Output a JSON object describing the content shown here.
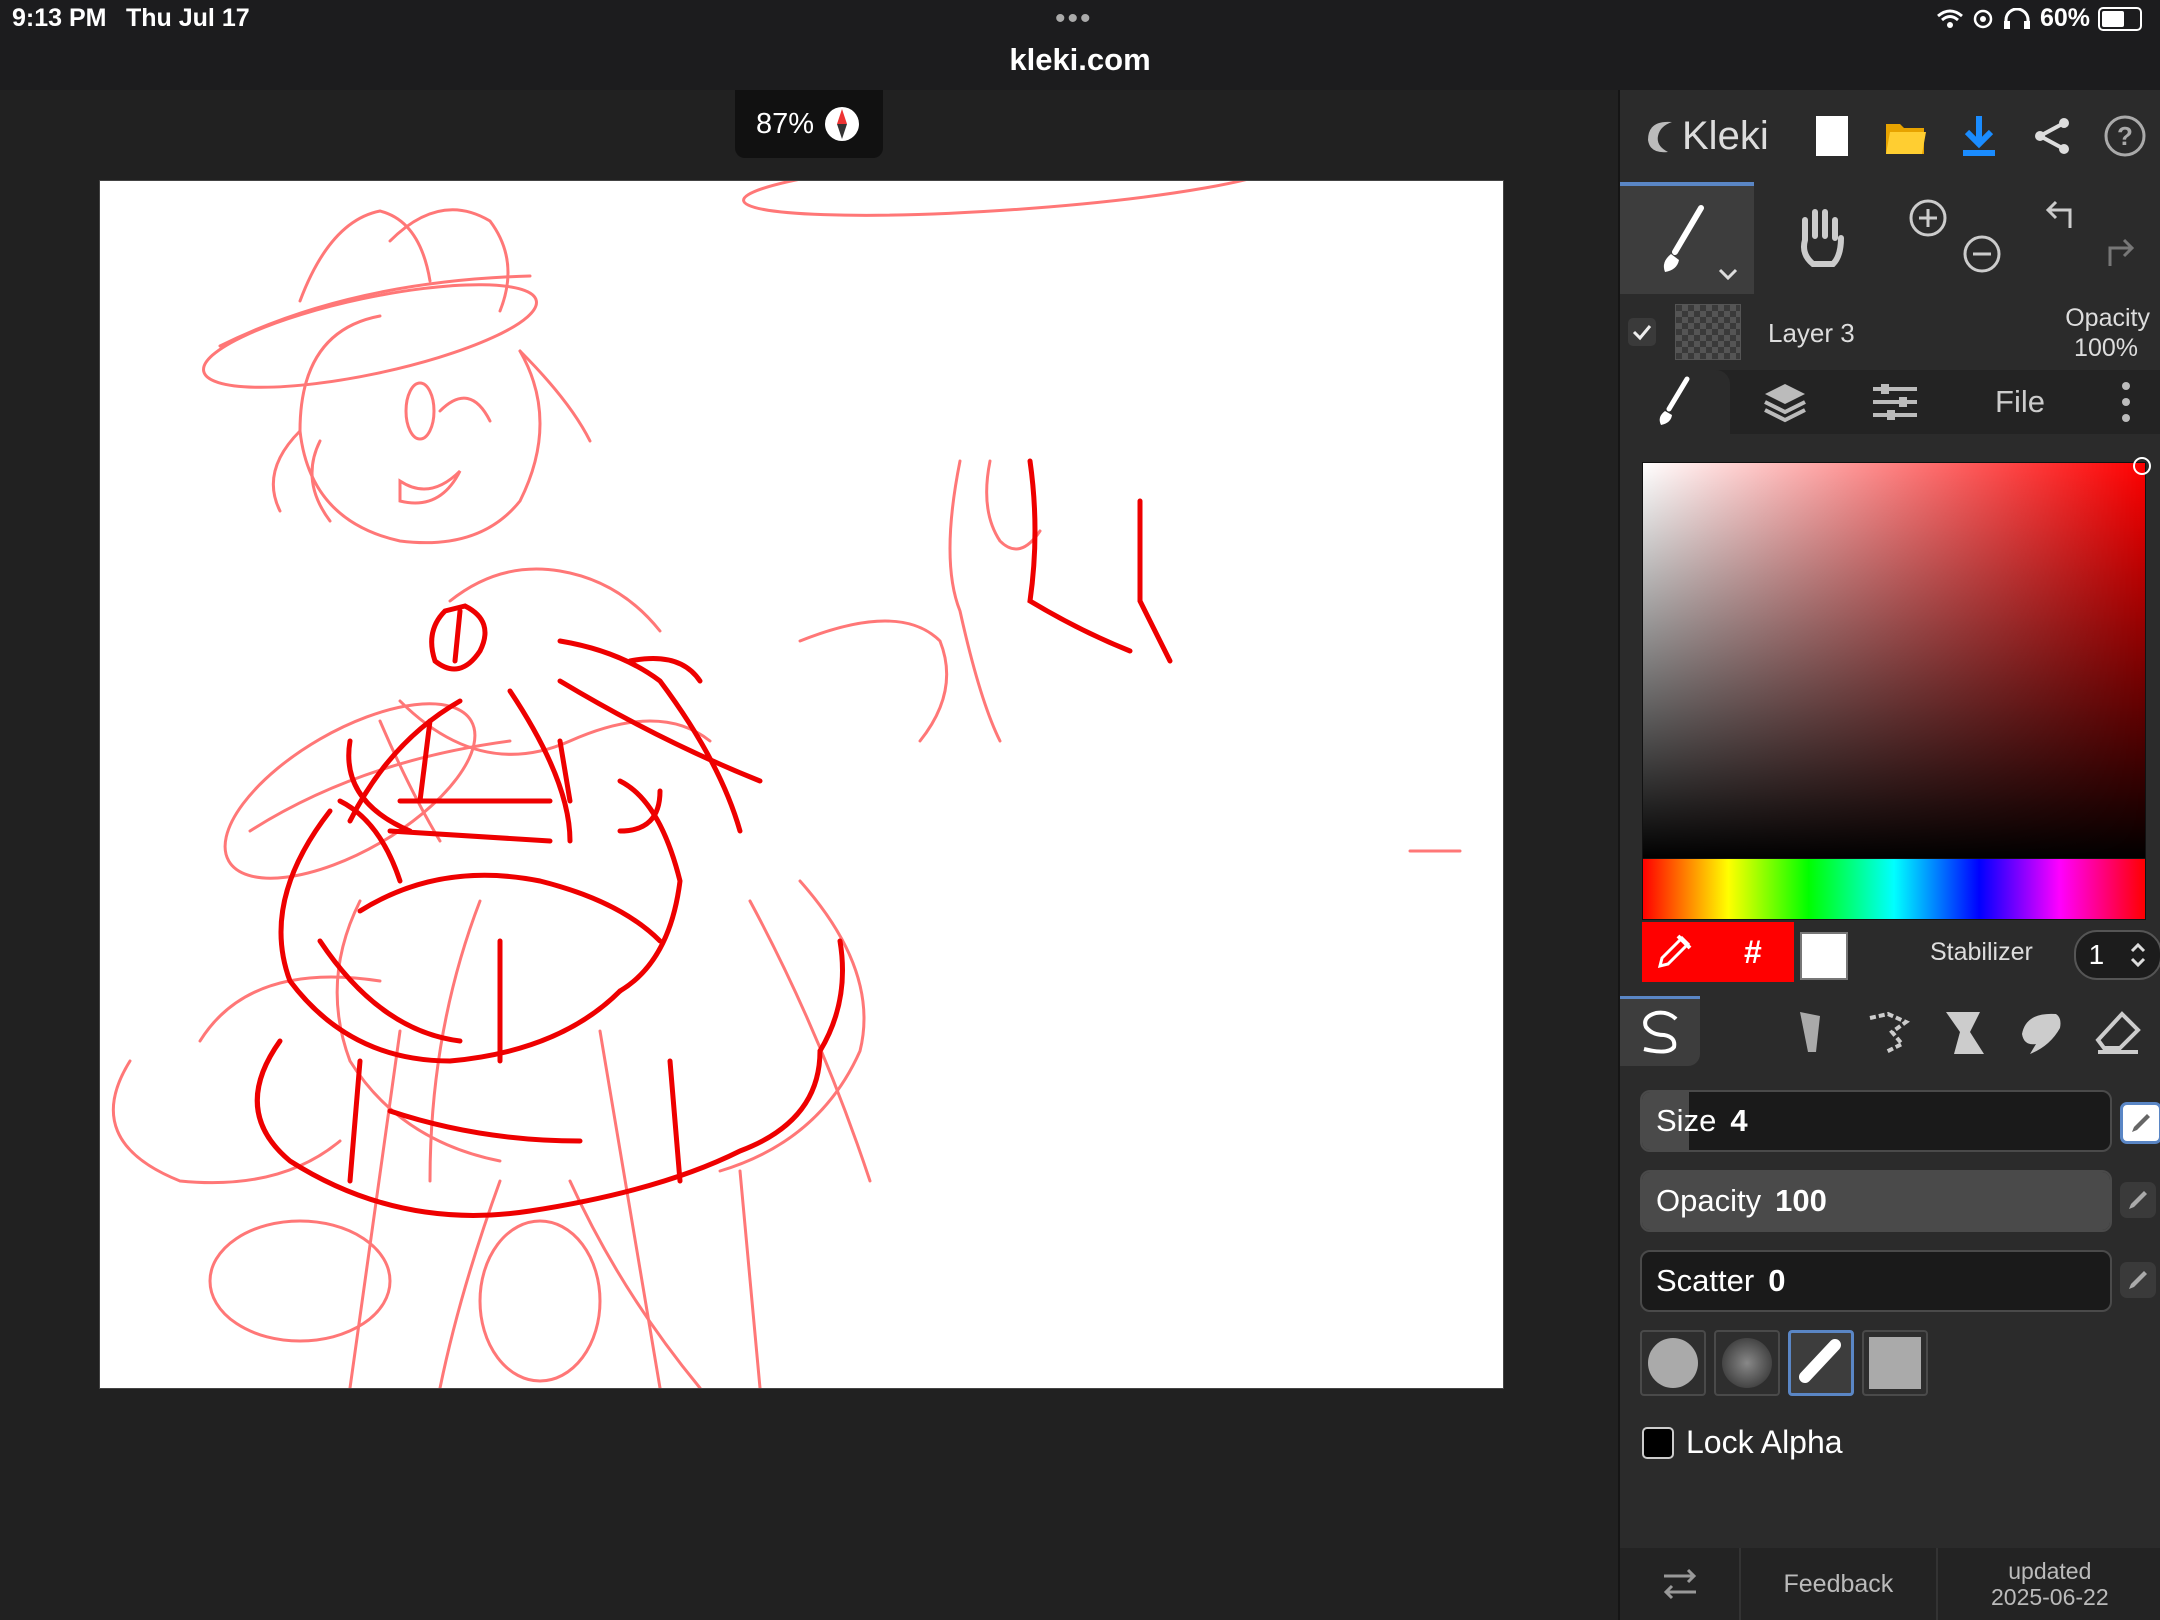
{
  "status_bar": {
    "time": "9:13 PM",
    "date": "Thu Jul 17",
    "url": "kleki.com",
    "battery": "60%",
    "battery_level": 0.6
  },
  "canvas": {
    "zoom": "87%"
  },
  "app": {
    "name": "Kleki"
  },
  "layer": {
    "name": "Layer 3",
    "opacity_label": "Opacity",
    "opacity_value": "100%"
  },
  "tabs": {
    "file": "File"
  },
  "color": {
    "primary": "#ff0000",
    "secondary": "#ffffff",
    "hex_symbol": "#"
  },
  "stabilizer": {
    "label": "Stabilizer",
    "value": "1"
  },
  "brush": {
    "size_label": "Size",
    "size_value": "4",
    "size_fill": 0.1,
    "opacity_label": "Opacity",
    "opacity_value": "100",
    "opacity_fill": 1.0,
    "scatter_label": "Scatter",
    "scatter_value": "0",
    "scatter_fill": 0.0
  },
  "lock_alpha": {
    "label": "Lock Alpha",
    "checked": false
  },
  "footer": {
    "feedback": "Feedback",
    "updated_label": "updated",
    "updated_date": "2025-06-22"
  },
  "accent": "#5a86c5",
  "stroke_color": "#ff0000"
}
